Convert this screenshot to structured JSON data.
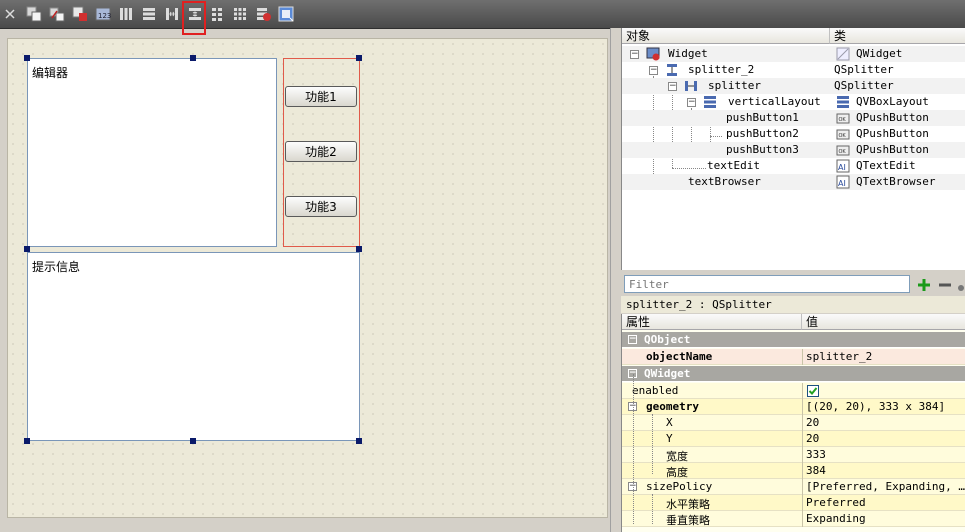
{
  "toolbar": {
    "icons": [
      "close-icon",
      "edit-widgets-icon",
      "edit-signals-icon",
      "edit-buddies-icon",
      "edit-tab-order-icon",
      "layout-horizontal-icon",
      "layout-vertical-icon",
      "splitter-horizontal-icon",
      "splitter-vertical-icon",
      "layout-form-icon",
      "layout-grid-icon",
      "break-layout-icon",
      "adjust-size-icon"
    ],
    "highlighted": "splitter-vertical-icon",
    "highlight_color": "#e02020"
  },
  "form": {
    "editor_label": "编辑器",
    "browser_label": "提示信息",
    "buttons": [
      "功能1",
      "功能2",
      "功能3"
    ]
  },
  "object_inspector": {
    "headers": {
      "object": "对象",
      "class": "类"
    },
    "rows": [
      {
        "name": "Widget",
        "class": "QWidget"
      },
      {
        "name": "splitter_2",
        "class": "QSplitter"
      },
      {
        "name": "splitter",
        "class": "QSplitter"
      },
      {
        "name": "verticalLayout",
        "class": "QVBoxLayout"
      },
      {
        "name": "pushButton1",
        "class": "QPushButton"
      },
      {
        "name": "pushButton2",
        "class": "QPushButton"
      },
      {
        "name": "pushButton3",
        "class": "QPushButton"
      },
      {
        "name": "textEdit",
        "class": "QTextEdit"
      },
      {
        "name": "textBrowser",
        "class": "QTextBrowser"
      }
    ]
  },
  "filter": {
    "placeholder": "Filter"
  },
  "selected": "splitter_2 : QSplitter",
  "property_editor": {
    "headers": {
      "property": "属性",
      "value": "值"
    },
    "rows": [
      {
        "group": true,
        "name": "QObject"
      },
      {
        "name": "objectName",
        "value": "splitter_2",
        "bold": true
      },
      {
        "group": true,
        "name": "QWidget"
      },
      {
        "name": "enabled",
        "value": "checked"
      },
      {
        "name": "geometry",
        "value": "[(20, 20), 333 x 384]",
        "bold": true
      },
      {
        "name": "X",
        "value": "20"
      },
      {
        "name": "Y",
        "value": "20"
      },
      {
        "name": "宽度",
        "value": "333"
      },
      {
        "name": "高度",
        "value": "384"
      },
      {
        "name": "sizePolicy",
        "value": "[Preferred, Expanding, …"
      },
      {
        "name": "水平策略",
        "value": "Preferred"
      },
      {
        "name": "垂直策略",
        "value": "Expanding"
      }
    ]
  },
  "colors": {
    "accent_green": "#1a9a1a",
    "selection": "#fbe9de",
    "group_header": "#a8a7a2"
  }
}
